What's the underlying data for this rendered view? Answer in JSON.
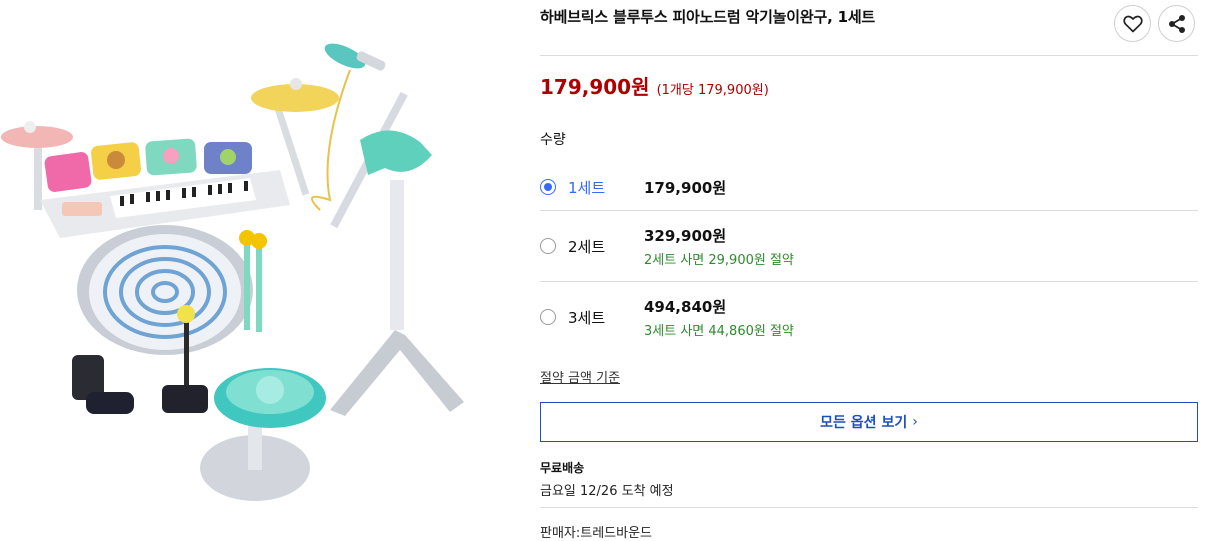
{
  "product": {
    "title": "하베브릭스 블루투스 피아노드럼 악기놀이완구, 1세트",
    "price": "179,900원",
    "unit_price": "(1개당 179,900원)",
    "image_icon": "product-photo-piano-drum-toy"
  },
  "actions": {
    "wishlist_icon": "heart-icon",
    "share_icon": "share-icon"
  },
  "quantity": {
    "label": "수량",
    "options": [
      {
        "name": "1세트",
        "price": "179,900원",
        "savings": "",
        "selected": true
      },
      {
        "name": "2세트",
        "price": "329,900원",
        "savings": "2세트 사면 29,900원 절약",
        "selected": false
      },
      {
        "name": "3세트",
        "price": "494,840원",
        "savings": "3세트 사면 44,860원 절약",
        "selected": false
      }
    ]
  },
  "savings_basis_link": "절약 금액 기준",
  "view_all_options": "모든 옵션 보기",
  "shipping": {
    "title": "무료배송",
    "eta": "금요일 12/26 도착 예정"
  },
  "seller": "판매자:트레드바운드",
  "colors": {
    "price": "#ae0000",
    "selected": "#346aff",
    "savings": "#2e8a2e",
    "button_border": "#1d4fbd"
  }
}
